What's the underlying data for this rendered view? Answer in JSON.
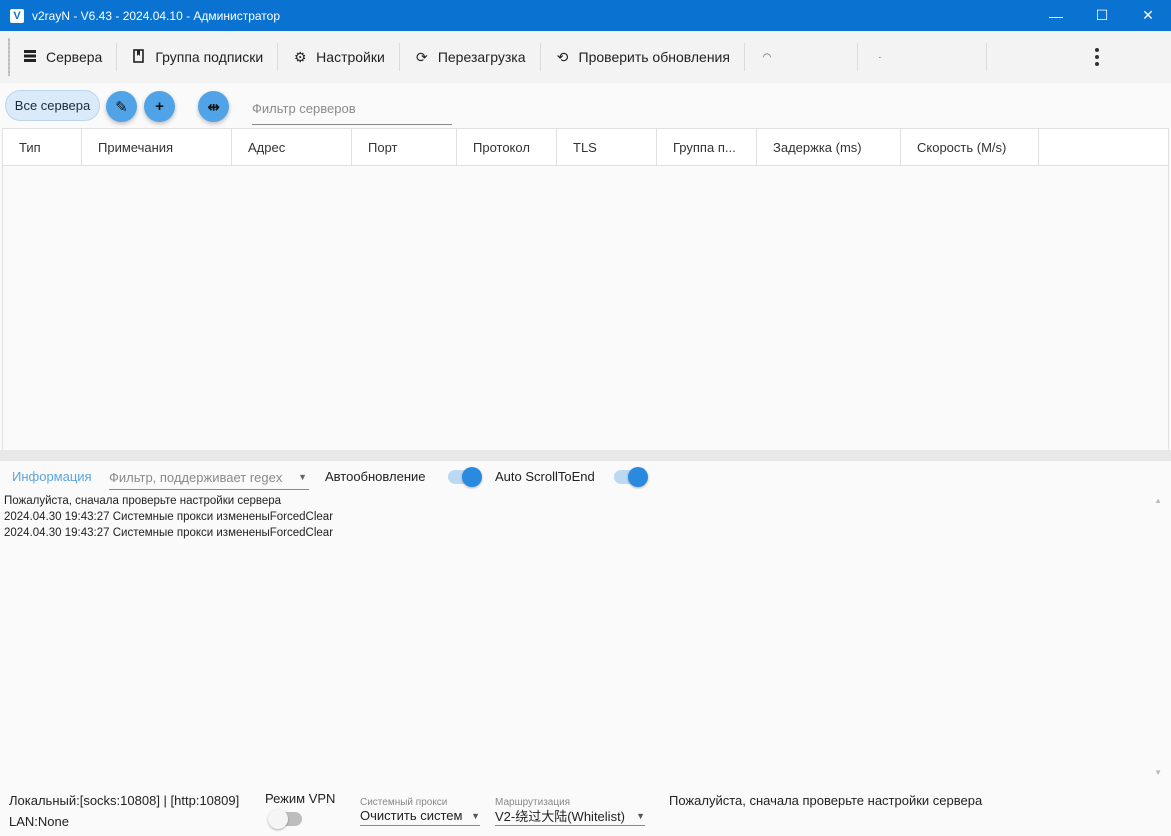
{
  "window": {
    "title": "v2rayN - V6.43 - 2024.04.10 - Администратор",
    "minimize_glyph": "—",
    "maximize_glyph": "☐",
    "close_glyph": "✕"
  },
  "toolbar": {
    "servers_label": "Сервера",
    "subscription_label": "Группа подписки",
    "settings_label": "Настройки",
    "reload_label": "Перезагрузка",
    "check_updates_label": "Проверить обновления"
  },
  "filter_row": {
    "all_servers_chip": "Все сервера",
    "edit_icon": "✎",
    "add_icon": "+",
    "move_icon": "⇹",
    "filter_placeholder": "Фильтр серверов"
  },
  "grid": {
    "columns": [
      "Тип",
      "Примечания",
      "Адрес",
      "Порт",
      "Протокол",
      "TLS",
      "Группа п...",
      "Задержка (ms)",
      "Скорость (M/s)"
    ]
  },
  "log": {
    "tab_label": "Информация",
    "filter_placeholder": "Фильтр, поддерживает regex",
    "auto_refresh_label": "Автообновление",
    "auto_scroll_label": "Auto ScrollToEnd",
    "lines": [
      "Пожалуйста, сначала проверьте настройки сервера",
      "2024.04.30 19:43:27 Системные прокси измененыForcedClear",
      "2024.04.30 19:43:27 Системные прокси измененыForcedClear"
    ]
  },
  "statusbar": {
    "local_ports": "Локальный:[socks:10808] | [http:10809]",
    "lan": "LAN:None",
    "vpn_mode_label": "Режим VPN",
    "system_proxy_caption": "Системный прокси",
    "system_proxy_value": "Очистить систем",
    "routing_caption": "Маршрутизация",
    "routing_value": "V2-绕过大陆(Whitelist)",
    "message": "Пожалуйста, сначала проверьте настройки сервера"
  }
}
